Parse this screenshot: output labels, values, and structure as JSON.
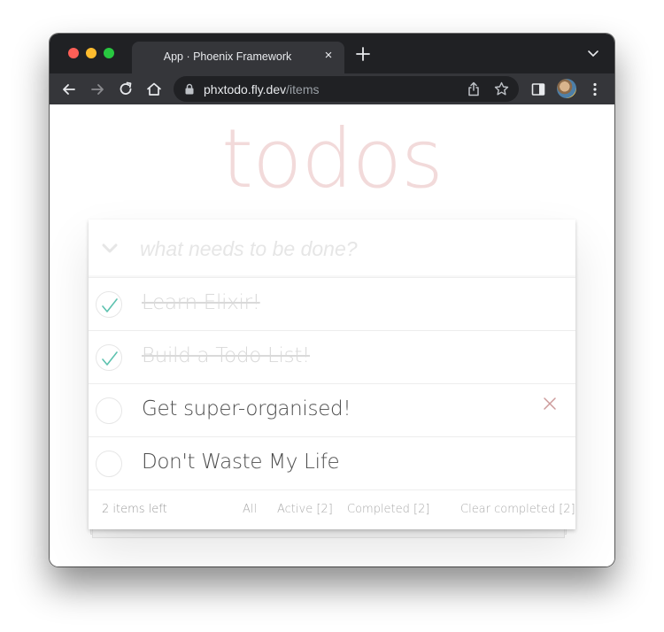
{
  "browser": {
    "tab_title": "App · Phoenix Framework",
    "tab_close": "×",
    "url_host": "phxtodo.fly.dev",
    "url_path": "/items"
  },
  "app": {
    "heading": "todos",
    "new_todo_placeholder": "what needs to be done?",
    "new_todo_value": "",
    "todos": [
      {
        "title": "Learn Elixir!",
        "completed": true
      },
      {
        "title": "Build a Todo List!",
        "completed": true
      },
      {
        "title": "Get super-organised!",
        "completed": false
      },
      {
        "title": "Don't Waste My Life",
        "completed": false
      }
    ],
    "footer": {
      "items_left": "2 items left",
      "filter_all": "All",
      "filter_active": "Active [2]",
      "filter_completed": "Completed [2]",
      "clear_completed": "Clear completed [2]"
    }
  },
  "colors": {
    "heading": "#f2dada",
    "check": "#5dc2af",
    "destroy": "#cc9a9a"
  }
}
